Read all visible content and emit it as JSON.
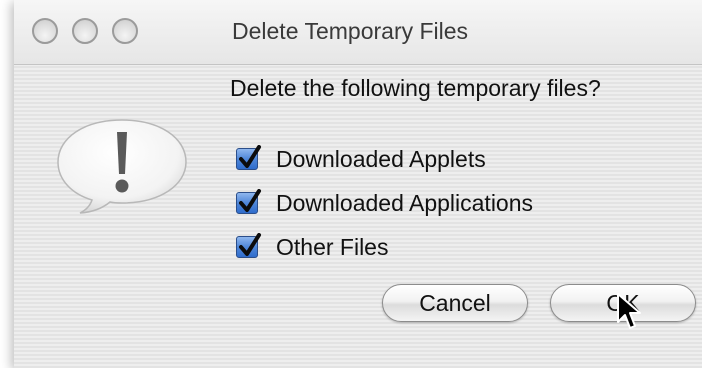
{
  "window": {
    "title": "Delete Temporary Files",
    "controls": [
      "close-button",
      "minimize-button",
      "zoom-button"
    ]
  },
  "dialog": {
    "icon": "alert-exclamation-icon",
    "message": "Delete the following temporary files?",
    "options": [
      {
        "label": "Downloaded Applets",
        "checked": true
      },
      {
        "label": "Downloaded Applications",
        "checked": true
      },
      {
        "label": "Other Files",
        "checked": true
      }
    ],
    "buttons": {
      "cancel_label": "Cancel",
      "ok_label": "OK"
    }
  },
  "colors": {
    "checkbox_fill": "#4f87d9",
    "window_bg": "#ececec"
  }
}
